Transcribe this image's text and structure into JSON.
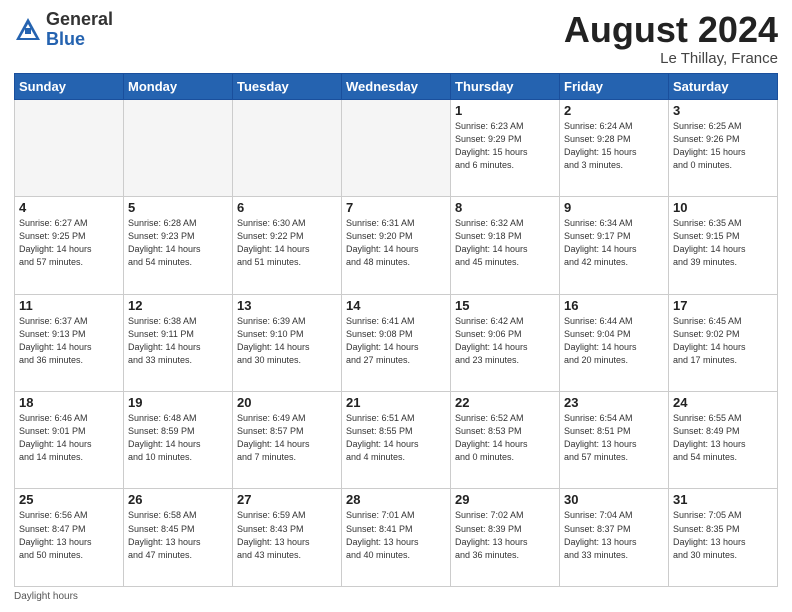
{
  "header": {
    "logo_general": "General",
    "logo_blue": "Blue",
    "month_title": "August 2024",
    "location": "Le Thillay, France"
  },
  "footer": {
    "label": "Daylight hours"
  },
  "days_of_week": [
    "Sunday",
    "Monday",
    "Tuesday",
    "Wednesday",
    "Thursday",
    "Friday",
    "Saturday"
  ],
  "weeks": [
    [
      {
        "day": "",
        "info": ""
      },
      {
        "day": "",
        "info": ""
      },
      {
        "day": "",
        "info": ""
      },
      {
        "day": "",
        "info": ""
      },
      {
        "day": "1",
        "info": "Sunrise: 6:23 AM\nSunset: 9:29 PM\nDaylight: 15 hours\nand 6 minutes."
      },
      {
        "day": "2",
        "info": "Sunrise: 6:24 AM\nSunset: 9:28 PM\nDaylight: 15 hours\nand 3 minutes."
      },
      {
        "day": "3",
        "info": "Sunrise: 6:25 AM\nSunset: 9:26 PM\nDaylight: 15 hours\nand 0 minutes."
      }
    ],
    [
      {
        "day": "4",
        "info": "Sunrise: 6:27 AM\nSunset: 9:25 PM\nDaylight: 14 hours\nand 57 minutes."
      },
      {
        "day": "5",
        "info": "Sunrise: 6:28 AM\nSunset: 9:23 PM\nDaylight: 14 hours\nand 54 minutes."
      },
      {
        "day": "6",
        "info": "Sunrise: 6:30 AM\nSunset: 9:22 PM\nDaylight: 14 hours\nand 51 minutes."
      },
      {
        "day": "7",
        "info": "Sunrise: 6:31 AM\nSunset: 9:20 PM\nDaylight: 14 hours\nand 48 minutes."
      },
      {
        "day": "8",
        "info": "Sunrise: 6:32 AM\nSunset: 9:18 PM\nDaylight: 14 hours\nand 45 minutes."
      },
      {
        "day": "9",
        "info": "Sunrise: 6:34 AM\nSunset: 9:17 PM\nDaylight: 14 hours\nand 42 minutes."
      },
      {
        "day": "10",
        "info": "Sunrise: 6:35 AM\nSunset: 9:15 PM\nDaylight: 14 hours\nand 39 minutes."
      }
    ],
    [
      {
        "day": "11",
        "info": "Sunrise: 6:37 AM\nSunset: 9:13 PM\nDaylight: 14 hours\nand 36 minutes."
      },
      {
        "day": "12",
        "info": "Sunrise: 6:38 AM\nSunset: 9:11 PM\nDaylight: 14 hours\nand 33 minutes."
      },
      {
        "day": "13",
        "info": "Sunrise: 6:39 AM\nSunset: 9:10 PM\nDaylight: 14 hours\nand 30 minutes."
      },
      {
        "day": "14",
        "info": "Sunrise: 6:41 AM\nSunset: 9:08 PM\nDaylight: 14 hours\nand 27 minutes."
      },
      {
        "day": "15",
        "info": "Sunrise: 6:42 AM\nSunset: 9:06 PM\nDaylight: 14 hours\nand 23 minutes."
      },
      {
        "day": "16",
        "info": "Sunrise: 6:44 AM\nSunset: 9:04 PM\nDaylight: 14 hours\nand 20 minutes."
      },
      {
        "day": "17",
        "info": "Sunrise: 6:45 AM\nSunset: 9:02 PM\nDaylight: 14 hours\nand 17 minutes."
      }
    ],
    [
      {
        "day": "18",
        "info": "Sunrise: 6:46 AM\nSunset: 9:01 PM\nDaylight: 14 hours\nand 14 minutes."
      },
      {
        "day": "19",
        "info": "Sunrise: 6:48 AM\nSunset: 8:59 PM\nDaylight: 14 hours\nand 10 minutes."
      },
      {
        "day": "20",
        "info": "Sunrise: 6:49 AM\nSunset: 8:57 PM\nDaylight: 14 hours\nand 7 minutes."
      },
      {
        "day": "21",
        "info": "Sunrise: 6:51 AM\nSunset: 8:55 PM\nDaylight: 14 hours\nand 4 minutes."
      },
      {
        "day": "22",
        "info": "Sunrise: 6:52 AM\nSunset: 8:53 PM\nDaylight: 14 hours\nand 0 minutes."
      },
      {
        "day": "23",
        "info": "Sunrise: 6:54 AM\nSunset: 8:51 PM\nDaylight: 13 hours\nand 57 minutes."
      },
      {
        "day": "24",
        "info": "Sunrise: 6:55 AM\nSunset: 8:49 PM\nDaylight: 13 hours\nand 54 minutes."
      }
    ],
    [
      {
        "day": "25",
        "info": "Sunrise: 6:56 AM\nSunset: 8:47 PM\nDaylight: 13 hours\nand 50 minutes."
      },
      {
        "day": "26",
        "info": "Sunrise: 6:58 AM\nSunset: 8:45 PM\nDaylight: 13 hours\nand 47 minutes."
      },
      {
        "day": "27",
        "info": "Sunrise: 6:59 AM\nSunset: 8:43 PM\nDaylight: 13 hours\nand 43 minutes."
      },
      {
        "day": "28",
        "info": "Sunrise: 7:01 AM\nSunset: 8:41 PM\nDaylight: 13 hours\nand 40 minutes."
      },
      {
        "day": "29",
        "info": "Sunrise: 7:02 AM\nSunset: 8:39 PM\nDaylight: 13 hours\nand 36 minutes."
      },
      {
        "day": "30",
        "info": "Sunrise: 7:04 AM\nSunset: 8:37 PM\nDaylight: 13 hours\nand 33 minutes."
      },
      {
        "day": "31",
        "info": "Sunrise: 7:05 AM\nSunset: 8:35 PM\nDaylight: 13 hours\nand 30 minutes."
      }
    ]
  ]
}
